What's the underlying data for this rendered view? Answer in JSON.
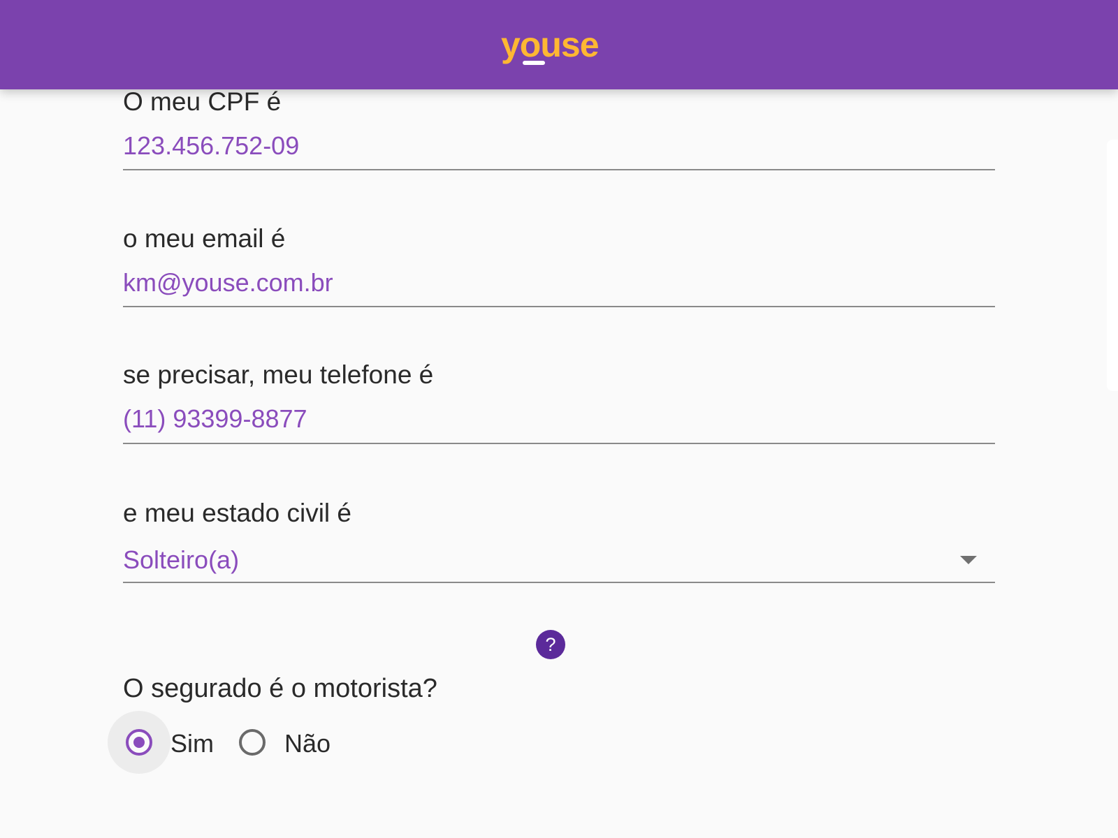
{
  "header": {
    "logo_text": "youse",
    "background_color": "#7b42ad",
    "logo_color": "#ffb733"
  },
  "form": {
    "cpf": {
      "label": "O meu CPF é",
      "value": "123.456.752-09"
    },
    "email": {
      "label": "o meu email é",
      "value": "km@youse.com.br"
    },
    "phone": {
      "label": "se precisar, meu telefone é",
      "value": "(11) 93399-8877"
    },
    "marital_status": {
      "label": "e meu estado civil é",
      "value": "Solteiro(a)",
      "icon": "dropdown-arrow-icon"
    },
    "help": {
      "icon": "help-icon",
      "glyph": "?"
    },
    "insured_is_driver": {
      "question": "O segurado é o motorista?",
      "options": [
        {
          "label": "Sim",
          "selected": true
        },
        {
          "label": "Não",
          "selected": false
        }
      ]
    }
  },
  "colors": {
    "accent": "#8a4cbc",
    "text": "#2a2a2a",
    "help_bg": "#5b2a9a",
    "background": "#fafafa"
  }
}
